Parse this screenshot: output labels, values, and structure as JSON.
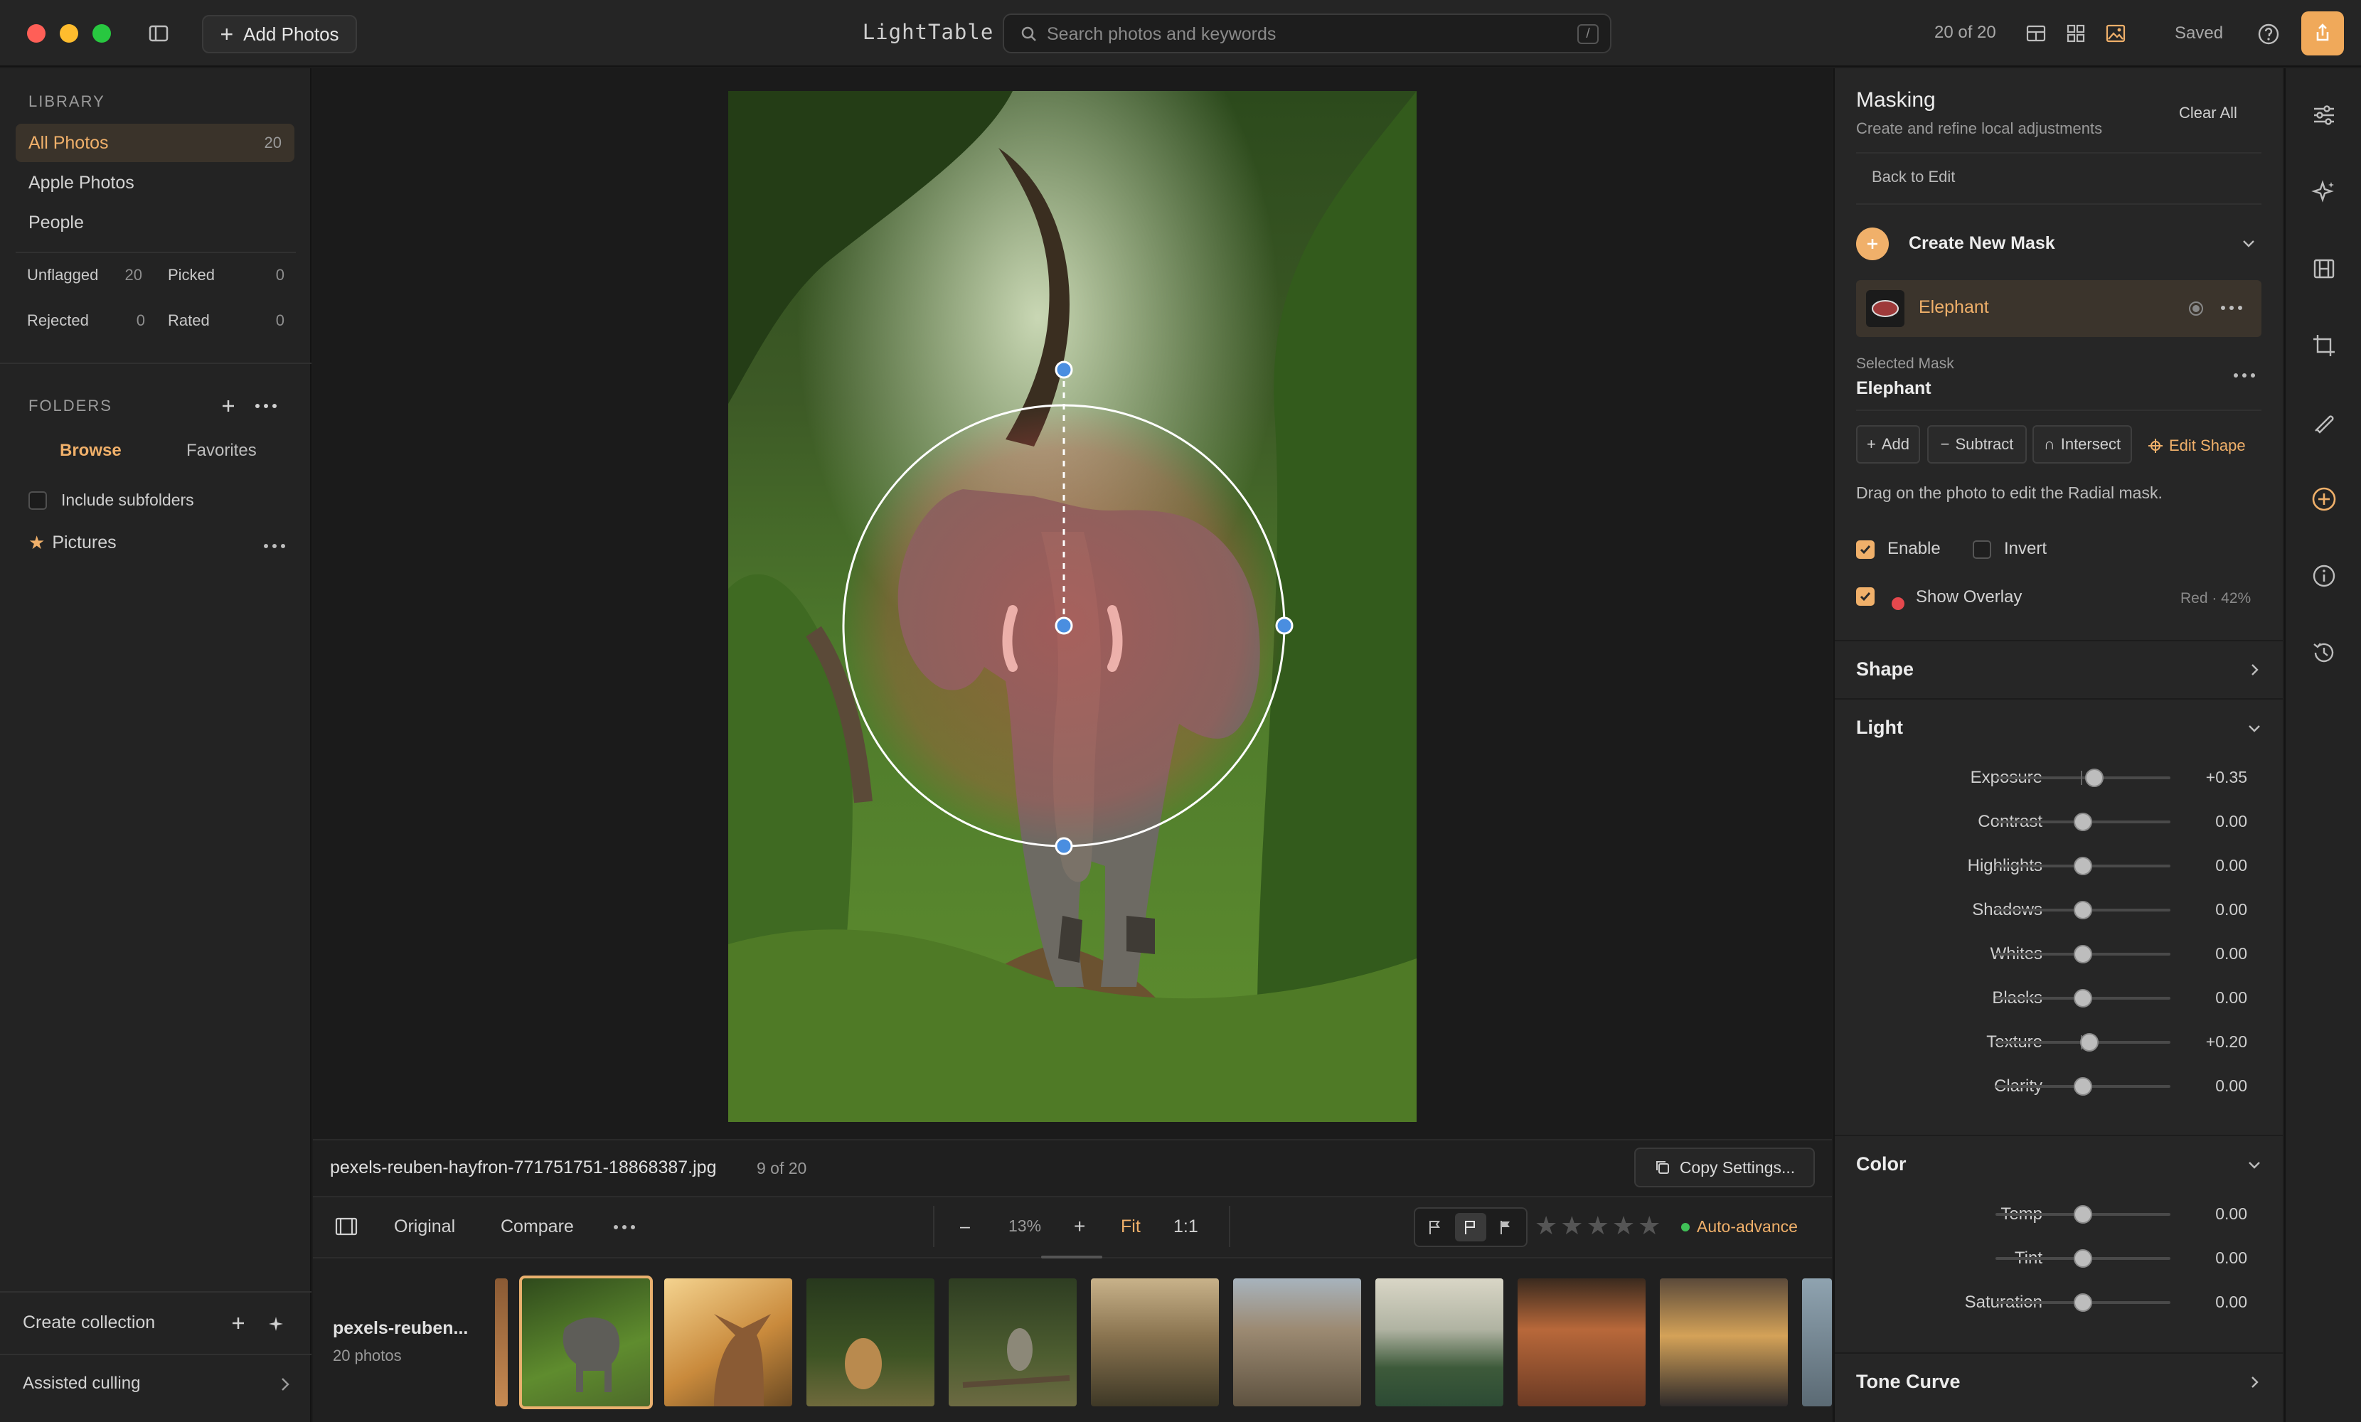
{
  "app": {
    "title": "LightTable",
    "count_label": "20 of 20",
    "saved_label": "Saved"
  },
  "toolbar_top": {
    "add_photos": "Add Photos",
    "search_placeholder": "Search photos and keywords",
    "search_shortcut": "/"
  },
  "library": {
    "heading": "LIBRARY",
    "items": [
      {
        "label": "All Photos",
        "count": "20",
        "active": true
      },
      {
        "label": "Apple Photos"
      },
      {
        "label": "People"
      }
    ],
    "stats": [
      {
        "label": "Unflagged",
        "count": "20"
      },
      {
        "label": "Picked",
        "count": "0"
      },
      {
        "label": "Rejected",
        "count": "0"
      },
      {
        "label": "Rated",
        "count": "0"
      }
    ]
  },
  "folders": {
    "heading": "FOLDERS",
    "tabs": [
      "Browse",
      "Favorites"
    ],
    "include_subfolders": "Include subfolders",
    "items": [
      {
        "label": "Pictures",
        "starred": true
      }
    ]
  },
  "sidebar_footer": {
    "create_collection": "Create collection",
    "assisted_culling": "Assisted culling"
  },
  "photo": {
    "filename": "pexels-reuben-hayfron-771751751-18868387.jpg",
    "index": "9 of 20"
  },
  "info_bar": {
    "copy_settings": "Copy Settings..."
  },
  "view_bar": {
    "original": "Original",
    "compare": "Compare",
    "zoom_minus": "–",
    "zoom_value": "13%",
    "zoom_plus": "+",
    "fit": "Fit",
    "one_to_one": "1:1",
    "auto_advance": "Auto-advance",
    "rating": 0,
    "max_rating": 5
  },
  "filmstrip": {
    "name": "pexels-reuben...",
    "count": "20 photos",
    "selected_index": 0
  },
  "masking": {
    "title": "Masking",
    "subtitle": "Create and refine local adjustments",
    "clear_all": "Clear All",
    "back_to_edit": "Back to Edit",
    "create_new_mask": "Create New Mask",
    "mask_name": "Elephant",
    "selected_mask_label": "Selected Mask",
    "selected_mask_name": "Elephant",
    "ops": {
      "add": "Add",
      "subtract": "Subtract",
      "intersect": "Intersect",
      "edit_shape": "Edit Shape"
    },
    "hint": "Drag on the photo to edit the Radial mask.",
    "enable": "Enable",
    "invert": "Invert",
    "show_overlay": "Show Overlay",
    "overlay_value": "Red · 42%",
    "overlay_color": "#e5484d",
    "enable_checked": true,
    "invert_checked": false,
    "overlay_checked": true
  },
  "sections": {
    "shape": "Shape",
    "light": "Light",
    "color": "Color",
    "tone_curve": "Tone Curve"
  },
  "light_sliders": [
    {
      "label": "Exposure",
      "value": "+0.35",
      "level": 0.35
    },
    {
      "label": "Contrast",
      "value": "0.00",
      "level": 0
    },
    {
      "label": "Highlights",
      "value": "0.00",
      "level": 0
    },
    {
      "label": "Shadows",
      "value": "0.00",
      "level": 0
    },
    {
      "label": "Whites",
      "value": "0.00",
      "level": 0
    },
    {
      "label": "Blacks",
      "value": "0.00",
      "level": 0
    },
    {
      "label": "Texture",
      "value": "+0.20",
      "level": 0.2
    },
    {
      "label": "Clarity",
      "value": "0.00",
      "level": 0
    }
  ],
  "color_sliders": [
    {
      "label": "Temp",
      "value": "0.00",
      "level": 0
    },
    {
      "label": "Tint",
      "value": "0.00",
      "level": 0
    },
    {
      "label": "Saturation",
      "value": "0.00",
      "level": 0
    }
  ],
  "theme": {
    "accent": "#f0b06a",
    "share_button": "#f0a95a"
  }
}
